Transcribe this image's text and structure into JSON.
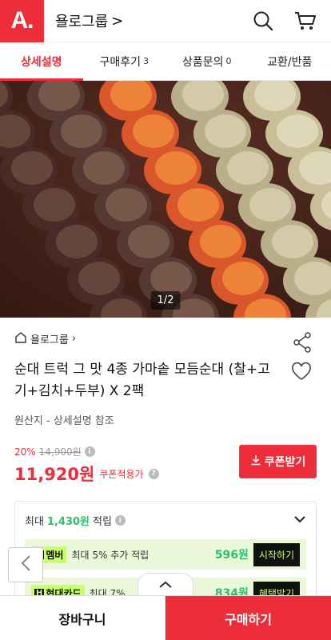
{
  "header": {
    "logo_text": "A.",
    "store_name": "욜로그룹",
    "store_chevron": ">"
  },
  "tabs": [
    {
      "label": "상세설명",
      "count": ""
    },
    {
      "label": "구매후기",
      "count": "3"
    },
    {
      "label": "상품문의",
      "count": "0"
    },
    {
      "label": "교환/반품",
      "count": ""
    }
  ],
  "hero": {
    "pager": "1/2"
  },
  "product": {
    "brand": "욜로그룹",
    "title": "순대 트럭 그 맛 4종 가마솥 모듬순대 (찰+고기+김치+두부) X 2팩",
    "origin": "원산지 - 상세설명 참조",
    "discount_rate": "20%",
    "original_price": "14,900원",
    "final_price": "11,920원",
    "coupon_applied": "쿠폰적용가",
    "coupon_button": "쿠폰받기"
  },
  "benefit": {
    "prefix": "최대",
    "points": "1,430원",
    "suffix": "적립",
    "rows": [
      {
        "badge": "멤버",
        "text": "최대 5% 추가 적립",
        "amount": "596원",
        "button": "시작하기"
      },
      {
        "badge": "현대카드",
        "text": "최대 7%",
        "amount": "834원",
        "button": "혜택받기"
      }
    ]
  },
  "bottom": {
    "cart": "장바구니",
    "buy": "구매하기"
  },
  "colors": {
    "accent": "#ee2d3a",
    "points": "#2bbf6a"
  },
  "icons": [
    "search-icon",
    "cart-icon",
    "share-icon",
    "heart-icon",
    "home-icon",
    "download-icon",
    "chevron-down-icon",
    "chevron-left-icon",
    "chevron-up-icon"
  ]
}
